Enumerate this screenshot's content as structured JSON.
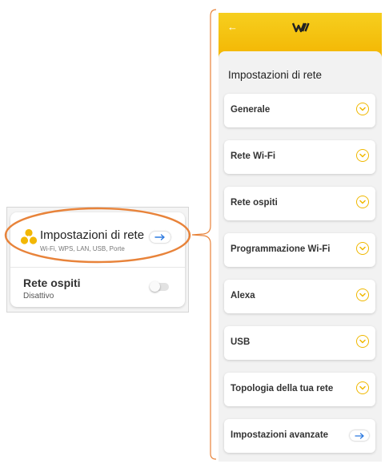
{
  "colors": {
    "brand_yellow": "#f3b400",
    "highlight_orange": "#e8833a",
    "accent_blue": "#2f7be0",
    "toggle_off": "#e2e2e2"
  },
  "left_card": {
    "network_settings": {
      "title": "Impostazioni di rete",
      "subtitle": "Wi-Fi, WPS, LAN, USB, Porte",
      "icon": "fan-network-icon",
      "action_icon": "arrow-right-icon"
    },
    "guest_network": {
      "title": "Rete ospiti",
      "status": "Disattivo",
      "toggle_on": false
    }
  },
  "phone": {
    "header": {
      "back_icon": "back-arrow-icon",
      "logo_icon": "brand-logo-icon"
    },
    "page_title": "Impostazioni di rete",
    "menu_items": [
      {
        "label": "Generale",
        "icon": "chevron-down-circle-icon"
      },
      {
        "label": "Rete Wi-Fi",
        "icon": "chevron-down-circle-icon"
      },
      {
        "label": "Rete ospiti",
        "icon": "chevron-down-circle-icon"
      },
      {
        "label": "Programmazione Wi-Fi",
        "icon": "chevron-down-circle-icon"
      },
      {
        "label": "Alexa",
        "icon": "chevron-down-circle-icon"
      },
      {
        "label": "USB",
        "icon": "chevron-down-circle-icon"
      },
      {
        "label": "Topologia della tua rete",
        "icon": "chevron-down-circle-icon"
      },
      {
        "label": "Impostazioni avanzate",
        "icon": "arrow-right-icon"
      }
    ]
  }
}
